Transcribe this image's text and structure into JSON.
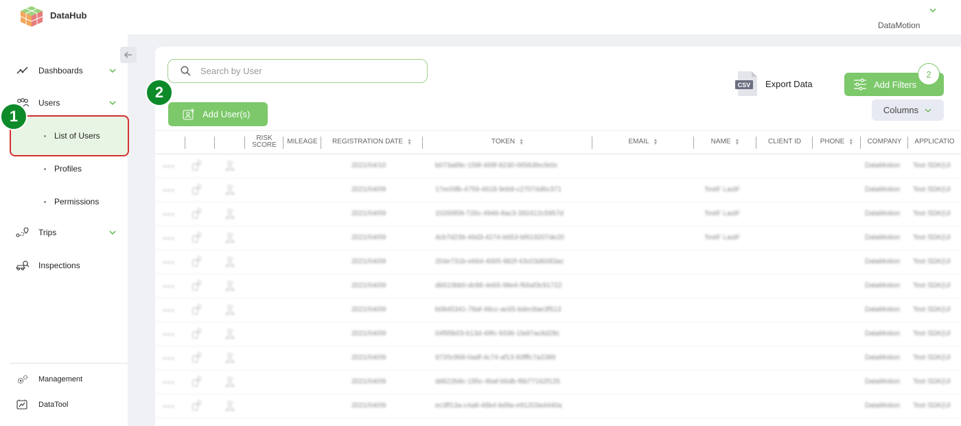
{
  "app": {
    "name": "DataHub",
    "org": "DataMotion"
  },
  "sidebar": {
    "items": [
      {
        "label": "Dashboards",
        "icon": "trend-line-icon",
        "expandable": true
      },
      {
        "label": "Users",
        "icon": "users-group-icon",
        "expandable": true
      },
      {
        "label": "Trips",
        "icon": "route-icon",
        "expandable": true
      },
      {
        "label": "Inspections",
        "icon": "car-search-icon",
        "expandable": false
      }
    ],
    "users_submenu": [
      "List of Users",
      "Profiles",
      "Permissions"
    ],
    "footer": [
      {
        "label": "Management",
        "icon": "gears-icon"
      },
      {
        "label": "DataTool",
        "icon": "data-tool-icon"
      }
    ]
  },
  "annotations": {
    "badge1": "1",
    "badge2": "2",
    "highlight_color": "#d32f2f",
    "badge_color": "#0d8a2a"
  },
  "toolbar": {
    "search_placeholder": "Search by User",
    "add_user_label": "Add User(s)",
    "export_label": "Export Data",
    "csv_label": "CSV",
    "filters_label": "Add Filters",
    "filters_count": "2",
    "columns_label": "Columns",
    "accent": "#7cc86a"
  },
  "table": {
    "headers": [
      {
        "label": "",
        "sortable": false
      },
      {
        "label": "",
        "sortable": false
      },
      {
        "label": "",
        "sortable": false
      },
      {
        "label": "RISK SCORE",
        "sortable": false
      },
      {
        "label": "MILEAGE",
        "sortable": false
      },
      {
        "label": "REGISTRATION DATE",
        "sortable": true
      },
      {
        "label": "TOKEN",
        "sortable": true
      },
      {
        "label": "EMAIL",
        "sortable": true
      },
      {
        "label": "NAME",
        "sortable": true
      },
      {
        "label": "CLIENT ID",
        "sortable": false
      },
      {
        "label": "PHONE",
        "sortable": true
      },
      {
        "label": "COMPANY",
        "sortable": false
      },
      {
        "label": "APPLICATIO",
        "sortable": false
      }
    ],
    "rows": [
      {
        "date": "2021/04/10",
        "token": "b073a89c-159f-469f-8230-06563fecfe0c",
        "name": "",
        "company": "DataMotion",
        "app": "Test SDK(Ul"
      },
      {
        "date": "2021/04/09",
        "token": "17ecf4fb-4759-4618-9eb9-c27074d6c371",
        "name": "TestF LastF",
        "company": "DataMotion",
        "app": "Test SDK(Ul"
      },
      {
        "date": "2021/04/09",
        "token": "10265f09-726c-4946-8ac3-392412c5957d",
        "name": "TestF LastF",
        "company": "DataMotion",
        "app": "Test SDK(Ul"
      },
      {
        "date": "2021/04/09",
        "token": "4cb7d236-46d3-4274-b653-bf619207de20",
        "name": "TestF LastF",
        "company": "DataMotion",
        "app": "Test SDK(Ul"
      },
      {
        "date": "2021/04/09",
        "token": "204e731b-e664-4005-982f-43c03d6083ac",
        "name": "",
        "company": "DataMotion",
        "app": "Test SDK(Ul"
      },
      {
        "date": "2021/04/09",
        "token": "d6610bb0-dc88-4eb5-98e6-f66af3c91722",
        "name": "",
        "company": "DataMotion",
        "app": "Test SDK(Ul"
      },
      {
        "date": "2021/04/09",
        "token": "b0845341-78af-48cc-ac65-bdec8ae3f513",
        "name": "",
        "company": "DataMotion",
        "app": "Test SDK(Ul"
      },
      {
        "date": "2021/04/09",
        "token": "04f95b03-b13d-49fc-9336-1fa97ac8d28c",
        "name": "",
        "company": "DataMotion",
        "app": "Test SDK(Ul"
      },
      {
        "date": "2021/04/09",
        "token": "9720c968-0adf-4c74-af13-83fffc7a2389",
        "name": "",
        "company": "DataMotion",
        "app": "Test SDK(Ul"
      },
      {
        "date": "2021/04/09",
        "token": "dd622b9c-195c-4baf-b5db-f6b77162f125",
        "name": "",
        "company": "DataMotion",
        "app": "Test SDK(Ul"
      },
      {
        "date": "2021/04/09",
        "token": "ec3ff13a-c4a8-46b4-bd9a-e91203a4440a",
        "name": "",
        "company": "DataMotion",
        "app": "Test SDK(Ul"
      }
    ]
  }
}
